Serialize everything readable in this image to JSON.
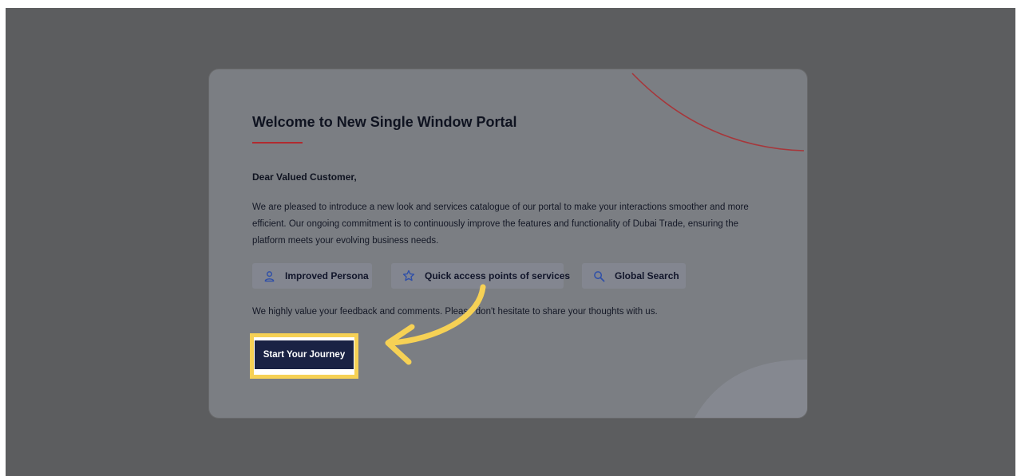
{
  "modal": {
    "title": "Welcome to New Single Window Portal",
    "greeting": "Dear Valued Customer,",
    "intro": "We are pleased to introduce a new look and services catalogue of our portal to make your interactions smoother and more efficient. Our ongoing commitment is to continuously improve the features and functionality of Dubai Trade, ensuring the platform meets your evolving business needs.",
    "features": [
      {
        "label": "Improved Persona",
        "icon": "user-icon"
      },
      {
        "label": "Quick access points of services",
        "icon": "star-icon"
      },
      {
        "label": "Global Search",
        "icon": "search-icon"
      }
    ],
    "feedback": "We highly value your feedback and comments. Please don't hesitate to share your thoughts with us.",
    "cta_label": "Start Your Journey"
  },
  "colors": {
    "backdrop": "#5c5d5f",
    "accent_red": "#b12a2f",
    "cta_background": "#1a2244",
    "icon_blue": "#2f4fa8",
    "highlight_yellow": "#f6d155"
  }
}
